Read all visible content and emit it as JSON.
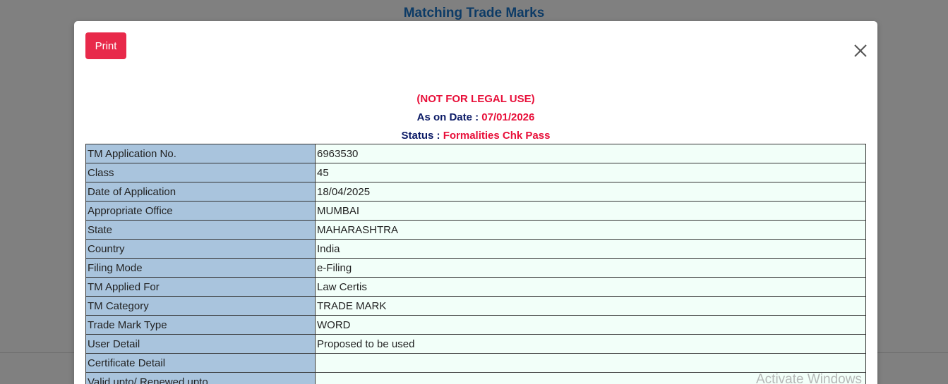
{
  "background": {
    "title": "Matching Trade Marks"
  },
  "modal": {
    "print_label": "Print",
    "close_symbol": "close-icon",
    "notice": "(NOT FOR LEGAL USE)",
    "as_on_label": "As on Date : ",
    "as_on_value": "07/01/2026",
    "status_label": "Status : ",
    "status_value": "Formalities Chk Pass"
  },
  "details": [
    {
      "label": "TM Application No.",
      "value": "6963530"
    },
    {
      "label": "Class",
      "value": "45"
    },
    {
      "label": "Date of Application",
      "value": "18/04/2025"
    },
    {
      "label": "Appropriate Office",
      "value": "MUMBAI"
    },
    {
      "label": "State",
      "value": "MAHARASHTRA"
    },
    {
      "label": "Country",
      "value": "India"
    },
    {
      "label": "Filing Mode",
      "value": "e-Filing"
    },
    {
      "label": "TM Applied For",
      "value": "Law Certis"
    },
    {
      "label": "TM Category",
      "value": "TRADE MARK"
    },
    {
      "label": "Trade Mark Type",
      "value": "WORD"
    },
    {
      "label": "User Detail",
      "value": "Proposed to be used"
    },
    {
      "label": "Certificate Detail",
      "value": ""
    },
    {
      "label": "Valid upto/ Renewed upto",
      "value": ""
    }
  ],
  "watermark": "Activate Windows",
  "colors": {
    "print_button": "#e8294a",
    "label_cell": "#a9c4dd",
    "value_cell": "#f2fff9",
    "notice_red": "#e8103a",
    "label_navy": "#0b1a66",
    "overlay": "#808080"
  }
}
